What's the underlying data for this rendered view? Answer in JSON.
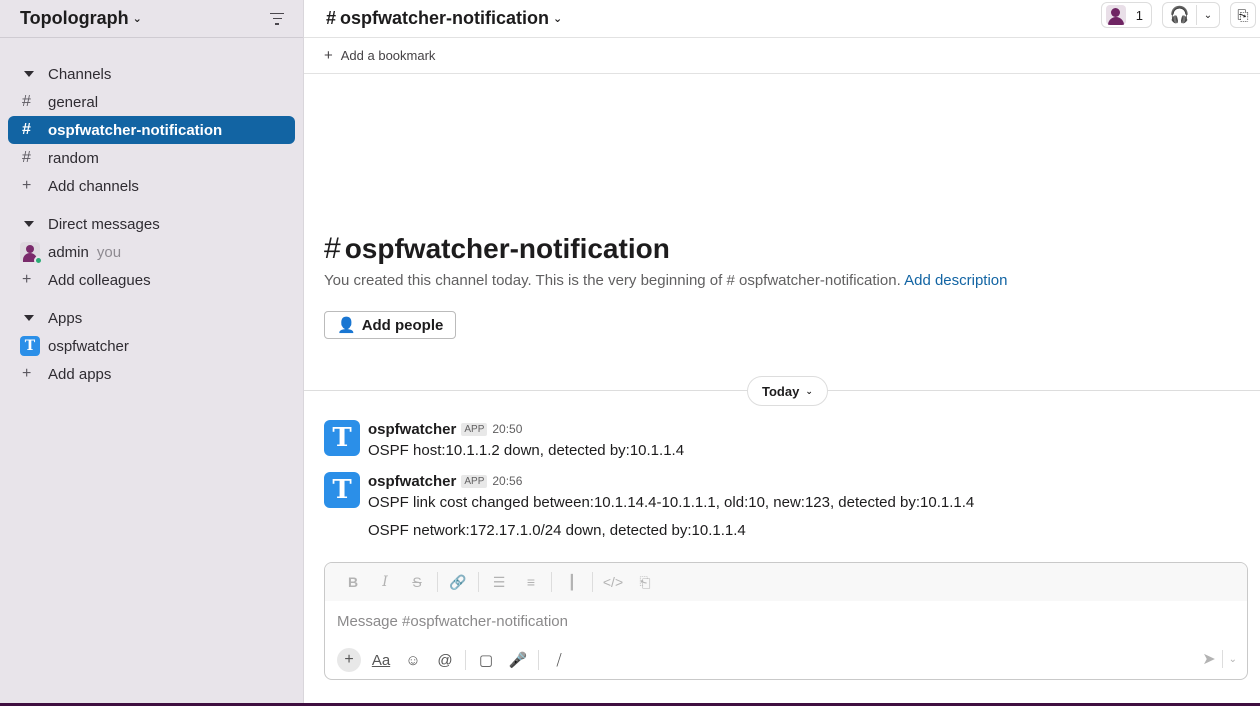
{
  "workspace": {
    "name": "Topolograph"
  },
  "sidebar": {
    "channels_label": "Channels",
    "channels": [
      {
        "prefix": "#",
        "label": "general"
      },
      {
        "prefix": "#",
        "label": "ospfwatcher-notification"
      },
      {
        "prefix": "#",
        "label": "random"
      }
    ],
    "add_channels": "Add channels",
    "dm_label": "Direct messages",
    "dm_user": "admin",
    "dm_you": "you",
    "add_colleagues": "Add colleagues",
    "apps_label": "Apps",
    "app_name": "ospfwatcher",
    "app_letter": "T",
    "add_apps": "Add apps"
  },
  "header": {
    "channel_title": "ospfwatcher-notification",
    "hash": "#",
    "member_count": "1",
    "add_bookmark": "Add a bookmark"
  },
  "intro": {
    "title": "ospfwatcher-notification",
    "description_prefix": "You created this channel today. This is the very beginning of # ospfwatcher-notification.",
    "add_description": "Add description",
    "add_people": "Add people"
  },
  "divider": {
    "label": "Today"
  },
  "messages": [
    {
      "sender": "ospfwatcher",
      "badge": "APP",
      "time": "20:50",
      "text": "OSPF host:10.1.1.2 down, detected by:10.1.1.4",
      "avatar_letter": "T"
    },
    {
      "sender": "ospfwatcher",
      "badge": "APP",
      "time": "20:56",
      "text": "OSPF link cost changed between:10.1.14.4-10.1.1.1, old:10, new:123, detected by:10.1.1.4",
      "avatar_letter": "T"
    }
  ],
  "followup": "OSPF network:172.17.1.0/24 down, detected by:10.1.1.4",
  "composer": {
    "placeholder": "Message #ospfwatcher-notification",
    "aa": "Aa"
  },
  "colors": {
    "sidebar_bg": "#e8e4ea",
    "active": "#1264a3",
    "app_blue": "#2b8fe8",
    "link": "#1264a3"
  }
}
